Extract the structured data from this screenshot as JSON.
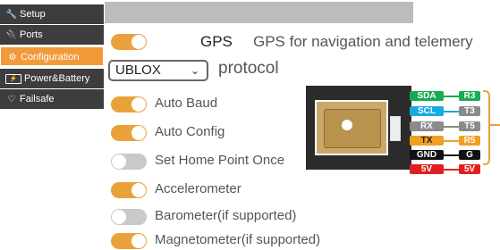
{
  "sidebar": {
    "items": [
      {
        "label": "Setup",
        "icon": "wrench-icon",
        "glyph": "🔧"
      },
      {
        "label": "Ports",
        "icon": "plug-icon",
        "glyph": "🔌"
      },
      {
        "label": "Configuration",
        "icon": "gear-icon",
        "glyph": "⚙"
      },
      {
        "label": "Power&Battery",
        "icon": "battery-icon",
        "glyph": "⚡"
      },
      {
        "label": "Failsafe",
        "icon": "shield-icon",
        "glyph": "♡"
      }
    ],
    "active_color": "#f29a3a",
    "item_color": "#3d3d3d"
  },
  "gps": {
    "enabled": true,
    "title": "GPS",
    "description": "GPS for navigation and telemery",
    "protocol_value": "UBLOX",
    "protocol_label": "protocol"
  },
  "options": [
    {
      "label": "Auto Baud",
      "on": true
    },
    {
      "label": "Auto Config",
      "on": true
    },
    {
      "label": "Set Home Point Once",
      "on": false
    },
    {
      "label": "Accelerometer",
      "on": true
    },
    {
      "label": "Barometer(if supported)",
      "on": false
    },
    {
      "label": "Magnetometer(if supported)",
      "on": true
    }
  ],
  "pins": [
    {
      "left": "SDA",
      "right": "R3",
      "color": "#1aaa55"
    },
    {
      "left": "SCL",
      "right": "T3",
      "color": "#17a9e0"
    },
    {
      "left": "RX",
      "right": "T5",
      "color": "#8a8a8a"
    },
    {
      "left": "TX",
      "right": "R5",
      "color": "#f0a020"
    },
    {
      "left": "GND",
      "right": "G",
      "color": "#111111"
    },
    {
      "left": "5V",
      "right": "5V",
      "color": "#e02020"
    }
  ],
  "colors": {
    "toggle_on": "#e9a23b",
    "toggle_off": "#c9c9c9"
  }
}
